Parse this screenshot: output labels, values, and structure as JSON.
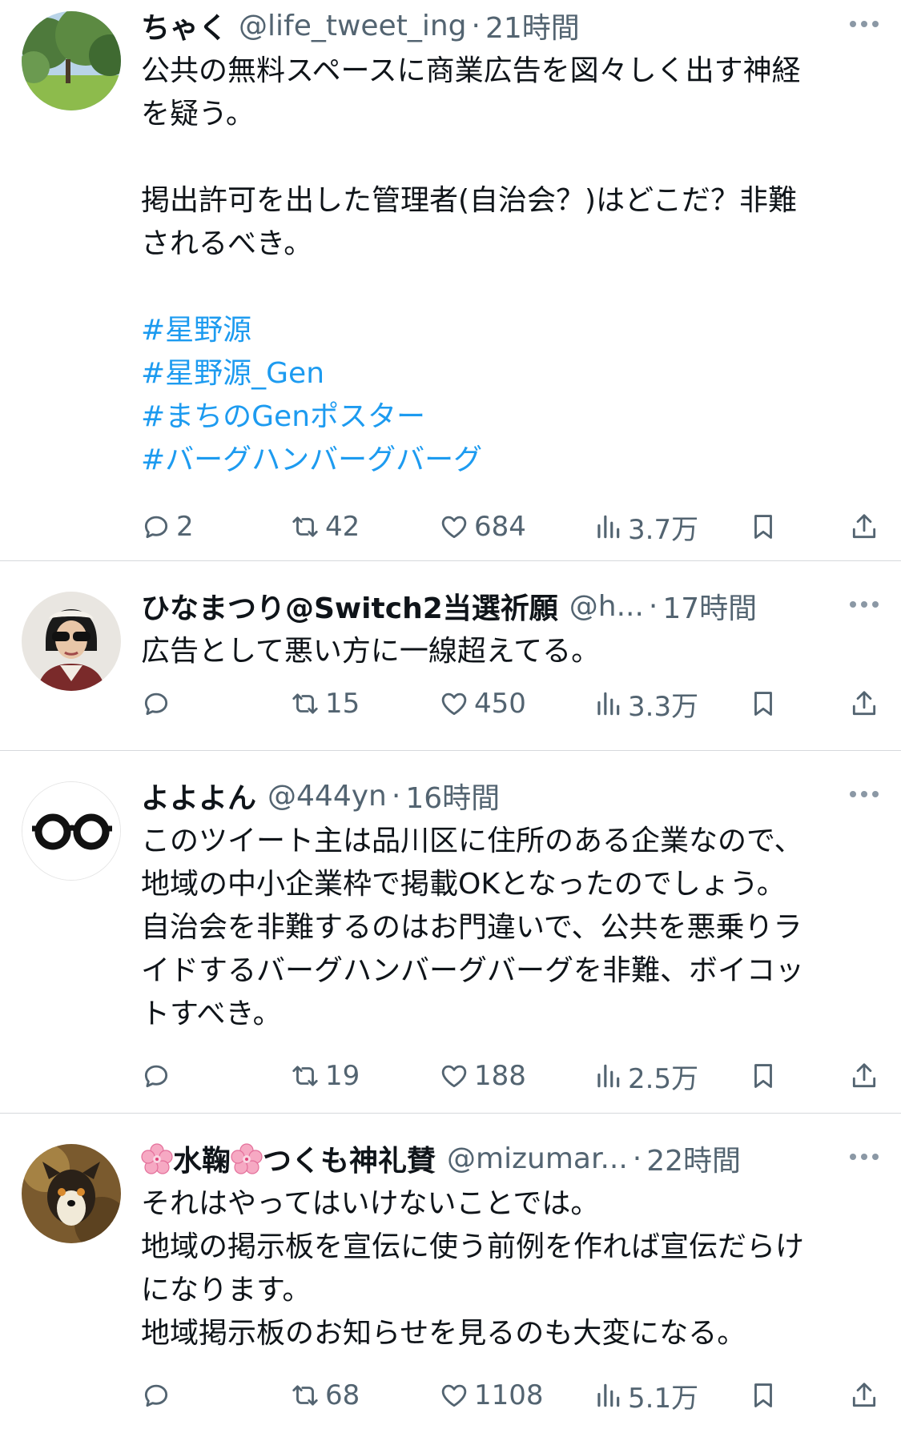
{
  "tweets": [
    {
      "name": "ちゃく",
      "handle": "@life_tweet_ing",
      "dot": "·",
      "time": "21時間",
      "body": [
        {
          "text": "公共の無料スペースに商業広告を図々しく出す神経"
        },
        {
          "text": "を疑う。"
        },
        {
          "text": ""
        },
        {
          "text": "掲出許可を出した管理者(自治会？)はどこだ？非難"
        },
        {
          "text": "されるべき。"
        },
        {
          "text": ""
        }
      ],
      "hashtags": [
        "#星野源",
        "#星野源_Gen",
        "#まちのGenポスター",
        "#バーグハンバーグバーグ"
      ],
      "replies": "2",
      "retweets": "42",
      "likes": "684",
      "views": "3.7万"
    },
    {
      "name": "ひなまつり@Switch2当選祈願",
      "handle": "@h...",
      "dot": "·",
      "time": "17時間",
      "body": [
        {
          "text": "広告として悪い方に一線超えてる。"
        }
      ],
      "replies": "",
      "retweets": "15",
      "likes": "450",
      "views": "3.3万"
    },
    {
      "name": "よよよん",
      "handle": "@444yn",
      "dot": "·",
      "time": "16時間",
      "body": [
        {
          "text": "このツイート主は品川区に住所のある企業なので、"
        },
        {
          "text": "地域の中小企業枠で掲載OKとなったのでしょう。"
        },
        {
          "text": "自治会を非難するのはお門違いで、公共を悪乗りラ"
        },
        {
          "text": "イドするバーグハンバーグバーグを非難、ボイコッ"
        },
        {
          "text": "トすべき。"
        }
      ],
      "replies": "",
      "retweets": "19",
      "likes": "188",
      "views": "2.5万"
    },
    {
      "name_parts": [
        "水鞠",
        "つくも神礼賛"
      ],
      "handle": "@mizumar...",
      "dot": "·",
      "time": "22時間",
      "body": [
        {
          "text": "それはやってはいけないことでは。"
        },
        {
          "text": "地域の掲示板を宣伝に使う前例を作れば宣伝だらけ"
        },
        {
          "text": "になります。"
        },
        {
          "text": "地域掲示板のお知らせを見るのも大変になる。"
        }
      ],
      "replies": "",
      "retweets": "68",
      "likes": "1108",
      "views": "5.1万"
    }
  ],
  "colors": {
    "text": "#0f1419",
    "secondary": "#536471",
    "hashtag": "#1d9bf0",
    "divider": "#d6d9dc"
  },
  "icons": [
    "reply-icon",
    "retweet-icon",
    "like-icon",
    "views-icon",
    "bookmark-icon",
    "share-icon",
    "more-icon",
    "cherry-blossom-icon"
  ]
}
